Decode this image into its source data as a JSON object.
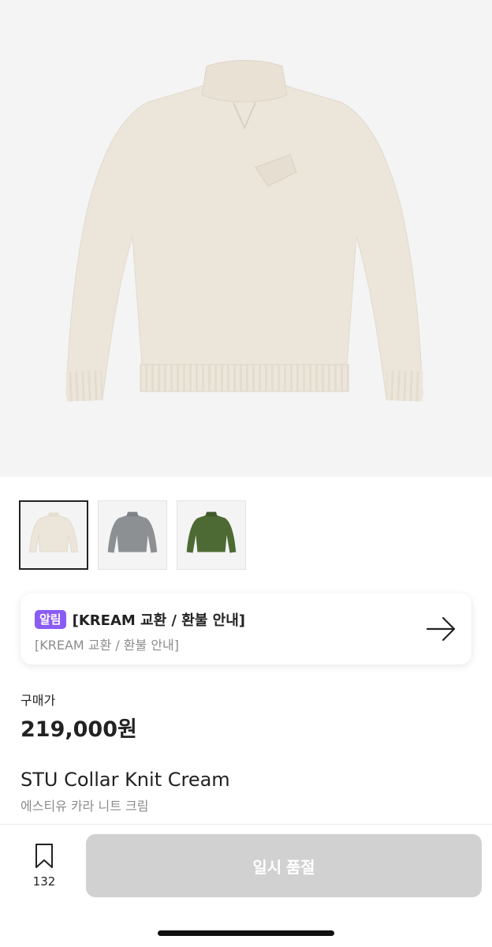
{
  "product": {
    "image_alt": "STU Collar Knit Cream",
    "thumbnails": [
      {
        "color": "#ece6da",
        "name": "cream"
      },
      {
        "color": "#8d9093",
        "name": "gray"
      },
      {
        "color": "#4e6a34",
        "name": "green"
      }
    ],
    "selected_thumbnail": 0
  },
  "notice": {
    "badge": "알림",
    "title": "[KREAM 교환 / 환불 안내]",
    "subtitle": "[KREAM 교환 / 환불 안내]",
    "icon": "arrow-right-icon"
  },
  "price": {
    "label": "구매가",
    "value": "219,000원"
  },
  "name": {
    "english": "STU Collar Knit Cream",
    "korean": "에스티유 카라 니트 크림"
  },
  "bottom_bar": {
    "bookmark_icon": "bookmark-icon",
    "bookmark_count": "132",
    "status_button": "일시 품절"
  },
  "colors": {
    "badge": "#8a5cf6",
    "disabled_button": "#d1d1d1"
  }
}
